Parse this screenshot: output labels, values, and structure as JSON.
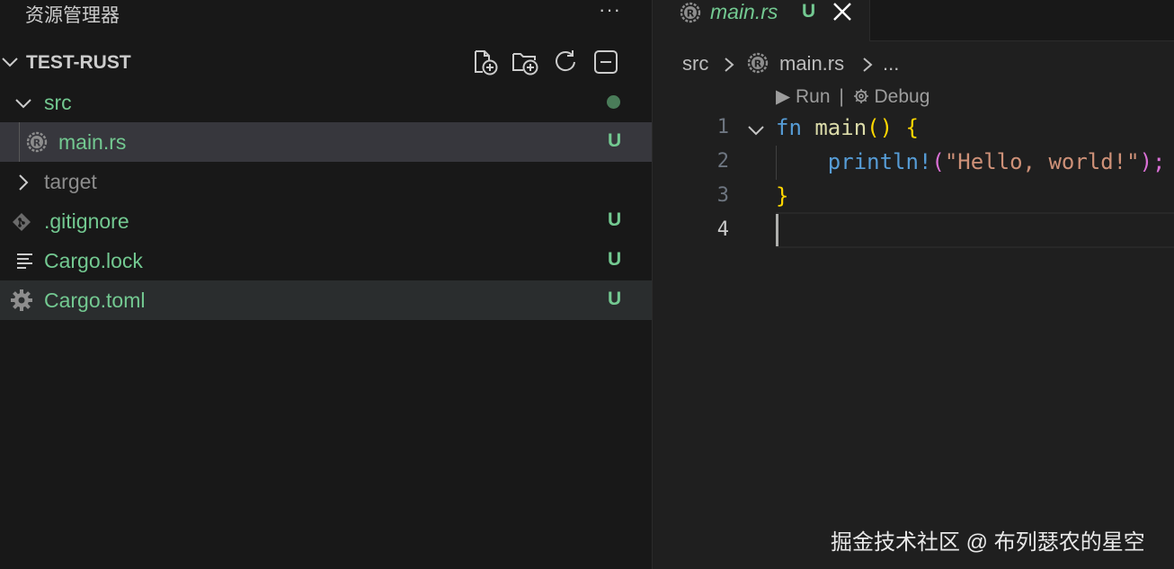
{
  "colors": {
    "untracked": "#73c991",
    "folder_untracked": "#73c991",
    "ignored": "#8c8c8c",
    "dot": "#4a7c59",
    "keyword": "#569cd6",
    "function": "#dcdcaa",
    "macro": "#569cd6",
    "string": "#ce9178",
    "bracket1": "#ffd700",
    "bracket2": "#da70d6",
    "cursor": "#aeafad"
  },
  "sidebar": {
    "title": "资源管理器",
    "more_label": "···",
    "project": {
      "name": "TEST-RUST",
      "actions": [
        "new-file-icon",
        "new-folder-icon",
        "refresh-icon",
        "collapse-all-icon"
      ]
    },
    "tree": [
      {
        "label": "src",
        "icon": "chevron-down-icon",
        "badge": "",
        "state": "folder-open"
      },
      {
        "label": "main.rs",
        "icon": "rust-file-icon",
        "badge": "U",
        "state": "active"
      },
      {
        "label": "target",
        "icon": "chevron-right-icon",
        "badge": "",
        "state": "ignored"
      },
      {
        "label": ".gitignore",
        "icon": "git-file-icon",
        "badge": "U",
        "state": "untracked"
      },
      {
        "label": "Cargo.lock",
        "icon": "lines-file-icon",
        "badge": "U",
        "state": "untracked"
      },
      {
        "label": "Cargo.toml",
        "icon": "gear-file-icon",
        "badge": "U",
        "state": "hover"
      }
    ]
  },
  "editor": {
    "tab": {
      "name": "main.rs",
      "badge": "U",
      "icon": "rust-file-icon"
    },
    "breadcrumb": {
      "folder": "src",
      "file": "main.rs",
      "more": "..."
    },
    "codelens": {
      "run": "▶ Run",
      "sep": "|",
      "debug": "Debug"
    },
    "lines": [
      {
        "num": "1",
        "tokens": [
          {
            "t": "fn ",
            "c": "keyword"
          },
          {
            "t": "main",
            "c": "function"
          },
          {
            "t": "() {",
            "c": "bracket1"
          }
        ]
      },
      {
        "num": "2",
        "tokens": [
          {
            "t": "    ",
            "c": "plain"
          },
          {
            "t": "println!",
            "c": "macro"
          },
          {
            "t": "(",
            "c": "bracket2"
          },
          {
            "t": "\"Hello, world!\"",
            "c": "string"
          },
          {
            "t": ");",
            "c": "bracket2"
          }
        ]
      },
      {
        "num": "3",
        "tokens": [
          {
            "t": "}",
            "c": "bracket1"
          }
        ]
      },
      {
        "num": "4",
        "tokens": []
      }
    ]
  },
  "watermark": "掘金技术社区 @ 布列瑟农的星空"
}
